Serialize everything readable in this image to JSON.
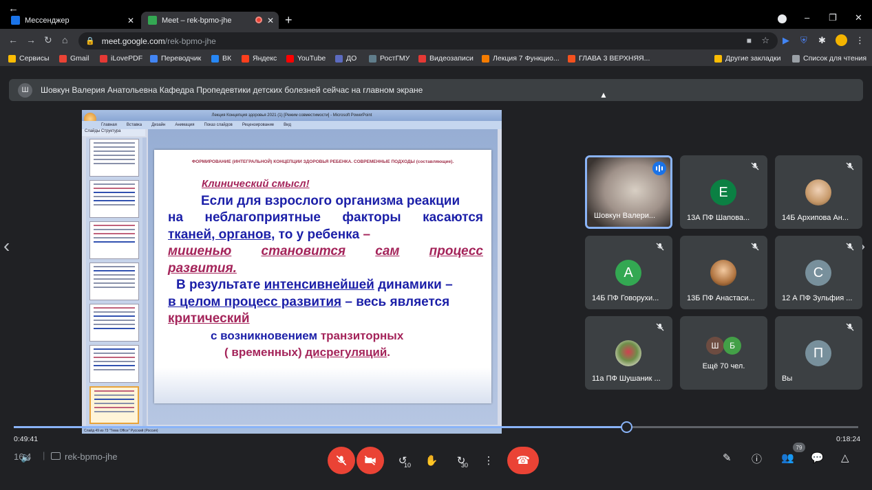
{
  "browser": {
    "tabs": [
      {
        "label": "Мессенджер",
        "color": "#1a73e8"
      },
      {
        "label": "Meet – rek-bpmo-jhe",
        "color": "#34a853"
      }
    ],
    "url_host": "meet.google.com",
    "url_path": "/rek-bpmo-jhe",
    "bookmarks": [
      {
        "label": "Сервисы",
        "color": "#fbbc04"
      },
      {
        "label": "Gmail",
        "color": "#ea4335"
      },
      {
        "label": "iLovePDF",
        "color": "#e53935"
      },
      {
        "label": "Переводчик",
        "color": "#4285f4"
      },
      {
        "label": "ВК",
        "color": "#2787f5"
      },
      {
        "label": "Яндекс",
        "color": "#fc3f1d"
      },
      {
        "label": "YouTube",
        "color": "#ff0000"
      },
      {
        "label": "ДО",
        "color": "#5c6bc0"
      },
      {
        "label": "РостГМУ",
        "color": "#607d8b"
      },
      {
        "label": "Видеозаписи",
        "color": "#e53935"
      },
      {
        "label": "Лекция 7 Функцио...",
        "color": "#f57c00"
      },
      {
        "label": "ГЛАВА 3 ВЕРХНЯЯ...",
        "color": "#f4511e"
      }
    ],
    "other_bookmarks": "Другие закладки",
    "reading_list": "Список для чтения"
  },
  "banner": {
    "avatar_letter": "Ш",
    "text": "Шовкун Валерия Анатольевна Кафедра Пропедевтики детских болезней сейчас на главном экране"
  },
  "presentation": {
    "window_title": "Лекция Концепция здоровья 2021 (1) [Режим совместимости] - Microsoft PowerPoint",
    "ribbon_tabs": [
      "Главная",
      "Вставка",
      "Дизайн",
      "Анимация",
      "Показ слайдов",
      "Рецензирование",
      "Вид"
    ],
    "panel_tabs": "Слайды   Структура",
    "status": "Слайд 49 из 73    \"Тема Office\"    Русский (Россия)",
    "slide": {
      "heading": "ФОРМИРОВАНИЕ (ИНТЕГРАЛЬНОЙ) КОНЦЕПЦИИ ЗДОРОВЬЯ РЕБЕНКА. СОВРЕМЕННЫЕ ПОДХОДЫ (составляющие).",
      "subtitle": "Клинический смысл!",
      "l1": "Если для взрослого организма реакции",
      "l2a": "на",
      "l2b": "неблагоприятные",
      "l2c": "факторы",
      "l2d": "касаются",
      "l3a": "тканей, органов",
      "l3b": ", то у ребенка",
      "l3c": " –",
      "l4a": "мишенью",
      "l4b": "становится",
      "l4c": "сам",
      "l4d": "процесс",
      "l5": "развития.",
      "l6a": "В результате ",
      "l6b": "интенсивнейшей",
      "l6c": " динамики –",
      "l7a": "в целом  процесс развития",
      "l7b": " – весь является",
      "l8": "критический",
      "l9a": "с возникновением ",
      "l9b": "транзиторных",
      "l10a": "( временных)  ",
      "l10b": "дисрегуляций",
      "l10c": "."
    }
  },
  "participants": [
    {
      "name": "Шовкун Валери...",
      "type": "video",
      "speaking": true
    },
    {
      "name": "13А ПФ Шапова...",
      "letter": "Е",
      "color": "#0b8043",
      "muted": true
    },
    {
      "name": "14Б Архипова Ан...",
      "type": "photo",
      "color": "#c79a6b",
      "muted": true
    },
    {
      "name": "14Б ПФ Говорухи...",
      "letter": "А",
      "color": "#33a852",
      "muted": true
    },
    {
      "name": "13Б ПФ Анастаси...",
      "type": "photo",
      "color": "#b07440",
      "muted": true
    },
    {
      "name": "12 А ПФ Зульфия ...",
      "letter": "С",
      "color": "#78909c",
      "muted": true
    },
    {
      "name": "11а ПФ Шушаник ...",
      "type": "photo",
      "color": "#6f8f4a",
      "muted": true
    },
    {
      "name": "Ещё 70 чел.",
      "type": "more",
      "letters": [
        "Ш",
        "Б"
      ],
      "colors": [
        "#6d4c41",
        "#43a047"
      ]
    },
    {
      "name": "Вы",
      "letter": "П",
      "color": "#78909c",
      "muted": false
    }
  ],
  "player": {
    "elapsed": "0:49:41",
    "remaining": "0:18:24",
    "progress_fraction": 0.7318,
    "meeting_code": "rek-bpmo-jhe",
    "time_partial": "16:4",
    "skip_back": "10",
    "skip_forward": "30",
    "people_count": "79"
  }
}
